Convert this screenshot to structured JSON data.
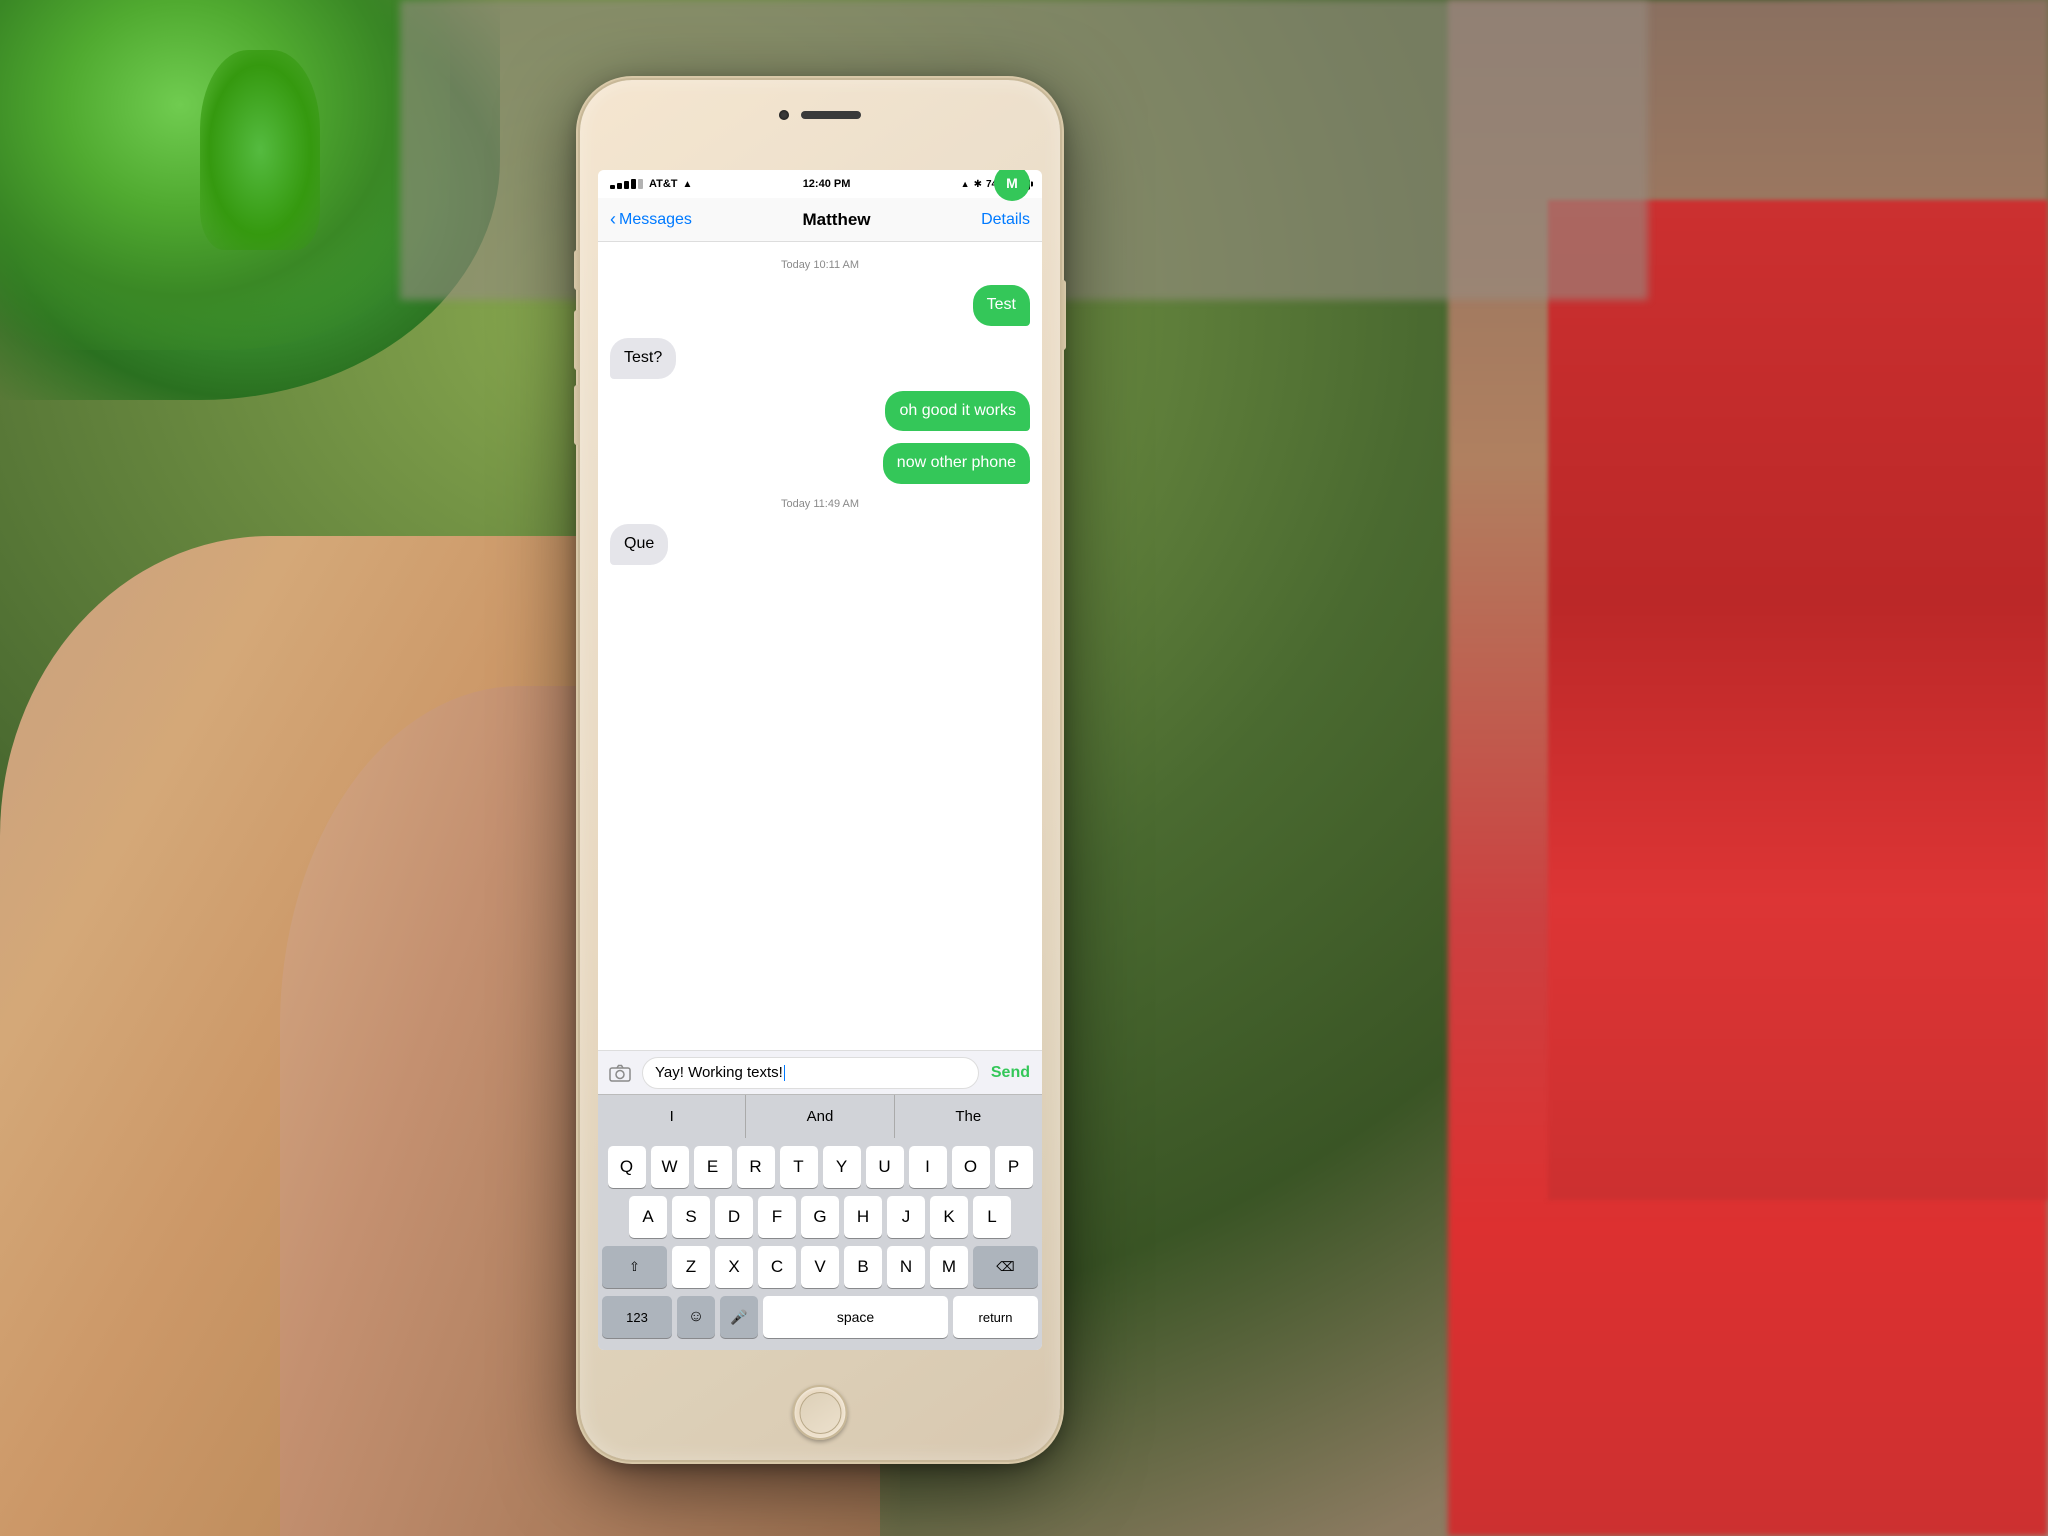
{
  "background": {
    "description": "Blurred office/desk background with Android figures and plants"
  },
  "phone": {
    "status_bar": {
      "carrier": "AT&T",
      "time": "12:40 PM",
      "battery_percent": "74%",
      "signal_strength": 4
    },
    "nav": {
      "back_label": "Messages",
      "title": "Matthew",
      "details_label": "Details"
    },
    "messages": [
      {
        "type": "timestamp",
        "text": "Today 10:11 AM"
      },
      {
        "type": "sent",
        "text": "Test"
      },
      {
        "type": "received",
        "text": "Test?"
      },
      {
        "type": "sent",
        "text": "oh good it works"
      },
      {
        "type": "sent",
        "text": "now other phone"
      },
      {
        "type": "timestamp",
        "text": "Today 11:49 AM"
      },
      {
        "type": "received",
        "text": "Que"
      }
    ],
    "input_bar": {
      "text_value": "Yay! Working texts!",
      "send_label": "Send"
    },
    "autocomplete": {
      "items": [
        "I",
        "And",
        "The"
      ]
    },
    "keyboard": {
      "row1": [
        "Q",
        "W",
        "E",
        "R",
        "T",
        "Y",
        "U",
        "I",
        "O",
        "P"
      ],
      "row2": [
        "A",
        "S",
        "D",
        "F",
        "G",
        "H",
        "J",
        "K",
        "L"
      ],
      "row3_special_left": "⇧",
      "row3": [
        "Z",
        "X",
        "C",
        "V",
        "B",
        "N",
        "M"
      ],
      "row3_special_right": "⌫",
      "row4_numbers": "123",
      "row4_emoji": "😊",
      "row4_mic": "🎤",
      "row4_space": "space",
      "row4_return": "return"
    }
  }
}
